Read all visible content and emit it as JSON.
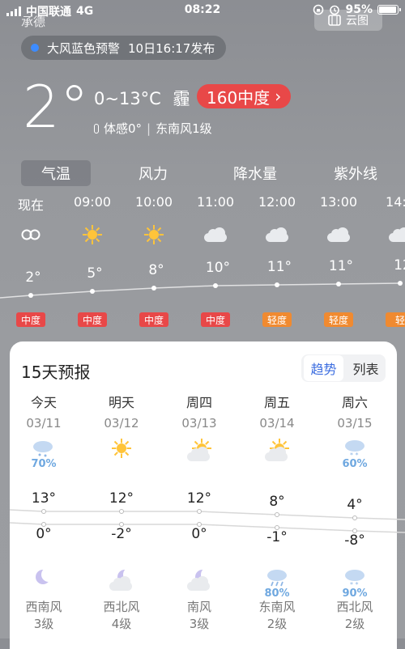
{
  "status_bar": {
    "carrier": "中国联通",
    "network": "4G",
    "time": "08:22",
    "battery": "95%",
    "battery_level": 0.95
  },
  "header": {
    "city_fragment": "承德",
    "share_label": "云图"
  },
  "alert": {
    "text": "大风蓝色预警",
    "issued": "10日16:17发布",
    "dot_color": "#3d8cff"
  },
  "current": {
    "temperature": "2°",
    "range": "0~13°C",
    "condition": "霾",
    "aqi_label": "160中度",
    "aqi_color": "#e84848",
    "feels_like": "体感0°",
    "wind": "东南风1级"
  },
  "tabs": [
    "气温",
    "风力",
    "降水量",
    "紫外线"
  ],
  "hourly": [
    {
      "time": "现在",
      "icon": "haze-icon",
      "temp": "2°",
      "aqi": "中度",
      "aqi_color": "#e84848"
    },
    {
      "time": "09:00",
      "icon": "sun-icon",
      "temp": "5°",
      "aqi": "中度",
      "aqi_color": "#e84848"
    },
    {
      "time": "10:00",
      "icon": "sun-icon",
      "temp": "8°",
      "aqi": "中度",
      "aqi_color": "#e84848"
    },
    {
      "time": "11:00",
      "icon": "cloud-icon",
      "temp": "10°",
      "aqi": "中度",
      "aqi_color": "#e84848"
    },
    {
      "time": "12:00",
      "icon": "cloud-icon",
      "temp": "11°",
      "aqi": "轻度",
      "aqi_color": "#f08a30"
    },
    {
      "time": "13:00",
      "icon": "cloud-icon",
      "temp": "11°",
      "aqi": "轻度",
      "aqi_color": "#f08a30"
    },
    {
      "time": "14:0",
      "icon": "cloud-icon",
      "temp": "12",
      "aqi": "轻",
      "aqi_color": "#f08a30"
    }
  ],
  "forecast": {
    "title": "15天预报",
    "toggle": [
      "趋势",
      "列表"
    ],
    "days": [
      {
        "name": "今天",
        "date": "03/11",
        "day_icon": "cloud-snow-icon",
        "day_pct": "70%",
        "high": "13°",
        "low": "0°",
        "night_icon": "moon-icon",
        "night_pct": "",
        "wind": "西南风",
        "level": "3级"
      },
      {
        "name": "明天",
        "date": "03/12",
        "day_icon": "sun-icon",
        "day_pct": "",
        "high": "12°",
        "low": "-2°",
        "night_icon": "moon-cloud-icon",
        "night_pct": "",
        "wind": "西北风",
        "level": "4级"
      },
      {
        "name": "周四",
        "date": "03/13",
        "day_icon": "sun-cloud-icon",
        "day_pct": "",
        "high": "12°",
        "low": "0°",
        "night_icon": "moon-cloud-icon",
        "night_pct": "",
        "wind": "南风",
        "level": "3级"
      },
      {
        "name": "周五",
        "date": "03/14",
        "day_icon": "sun-cloud-icon",
        "day_pct": "",
        "high": "8°",
        "low": "-1°",
        "night_icon": "rain-icon",
        "night_pct": "80%",
        "wind": "东南风",
        "level": "2级"
      },
      {
        "name": "周六",
        "date": "03/15",
        "day_icon": "snow-icon",
        "day_pct": "60%",
        "high": "4°",
        "low": "-8°",
        "night_icon": "snow-icon",
        "night_pct": "90%",
        "wind": "西北风",
        "level": "2级"
      }
    ]
  }
}
